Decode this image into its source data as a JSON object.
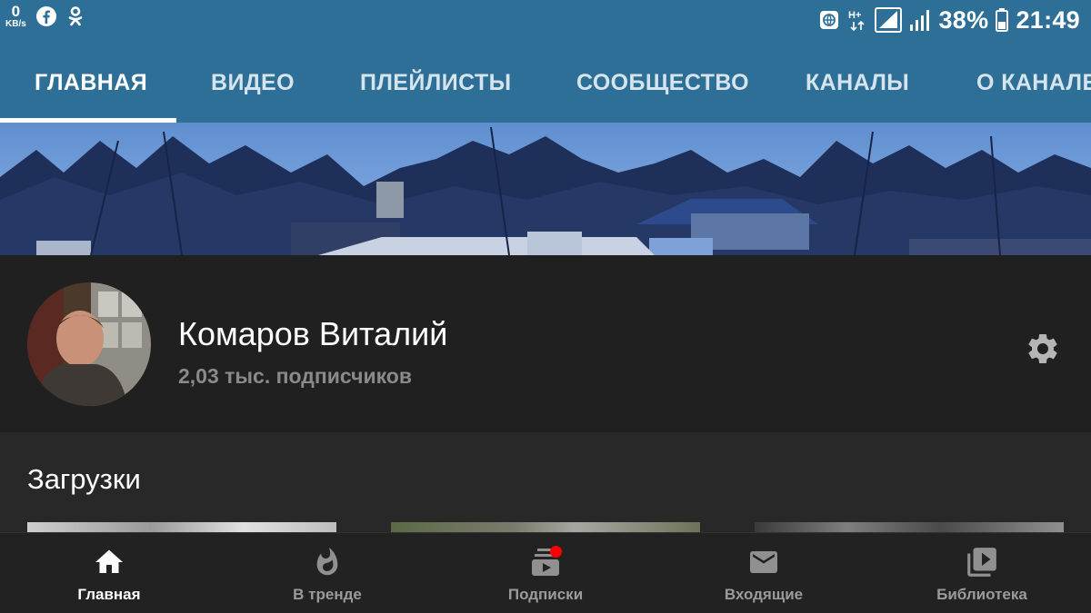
{
  "status_bar": {
    "net_speed_value": "0",
    "net_speed_unit": "KB/s",
    "left_icons": [
      "facebook-icon",
      "odnoklassniki-icon"
    ],
    "right_icons": [
      "data-saver-icon",
      "network-type-icon",
      "signal-icon",
      "signal-icon"
    ],
    "network_type": "H+",
    "battery_percent": "38%",
    "time": "21:49",
    "bg_color": "#2e6f97"
  },
  "tabs": [
    {
      "label": "ГЛАВНАЯ",
      "active": true
    },
    {
      "label": "ВИДЕО",
      "active": false
    },
    {
      "label": "ПЛЕЙЛИСТЫ",
      "active": false
    },
    {
      "label": "СООБЩЕСТВО",
      "active": false
    },
    {
      "label": "КАНАЛЫ",
      "active": false
    },
    {
      "label": "О КАНАЛЕ",
      "active": false
    }
  ],
  "channel": {
    "name": "Комаров Виталий",
    "subscribers": "2,03 тыс. подписчиков",
    "settings_icon": "gear-icon"
  },
  "uploads": {
    "title": "Загрузки",
    "thumbnail_count": 3
  },
  "bottom_nav": [
    {
      "label": "Главная",
      "icon": "home-icon",
      "active": true
    },
    {
      "label": "В тренде",
      "icon": "trending-icon",
      "active": false
    },
    {
      "label": "Подписки",
      "icon": "subscriptions-icon",
      "active": false,
      "badge": true
    },
    {
      "label": "Входящие",
      "icon": "inbox-icon",
      "active": false
    },
    {
      "label": "Библиотека",
      "icon": "library-icon",
      "active": false
    }
  ],
  "colors": {
    "accent": "#2e6f97",
    "background": "#212121",
    "badge": "#ff0000"
  }
}
